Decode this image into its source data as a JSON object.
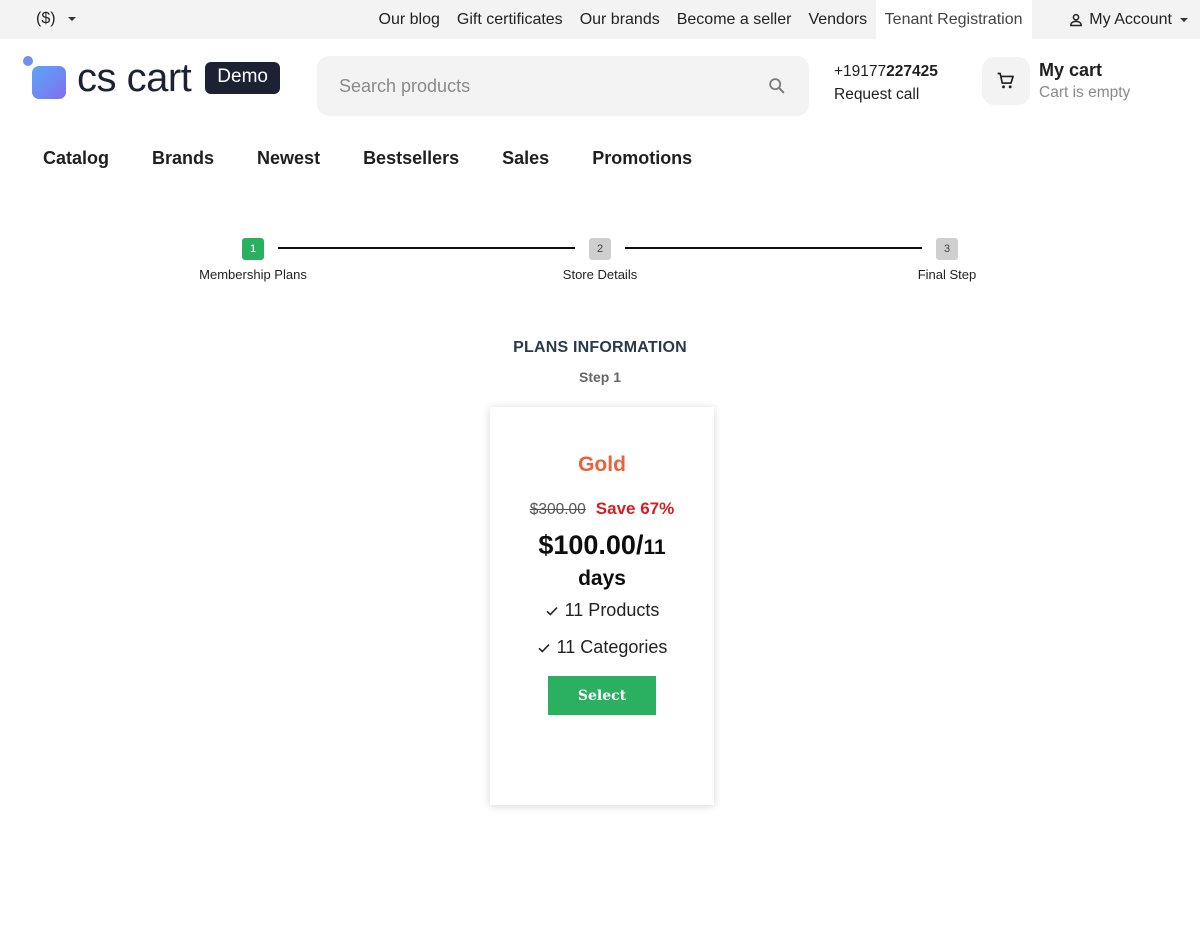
{
  "topbar": {
    "currency": "($)",
    "links": [
      "Our blog",
      "Gift certificates",
      "Our brands",
      "Become a seller",
      "Vendors",
      "Tenant Registration"
    ],
    "account": "My Account"
  },
  "header": {
    "logo_text": "cs cart",
    "demo_badge": "Demo",
    "search_placeholder": "Search products",
    "phone_prefix": "+19177",
    "phone_bold": "227425",
    "request_call": "Request call",
    "cart_title": "My cart",
    "cart_status": "Cart is empty"
  },
  "nav": [
    "Catalog",
    "Brands",
    "Newest",
    "Bestsellers",
    "Sales",
    "Promotions"
  ],
  "steps": [
    {
      "num": "1",
      "label": "Membership Plans",
      "state": "done"
    },
    {
      "num": "2",
      "label": "Store Details",
      "state": "todo"
    },
    {
      "num": "3",
      "label": "Final Step",
      "state": "todo"
    }
  ],
  "plans": {
    "title": "PLANS INFORMATION",
    "subtitle": "Step 1"
  },
  "plan_card": {
    "name": "Gold",
    "old_price": "$300.00",
    "save": "Save 67%",
    "price": "$100.00/",
    "period_num": "11",
    "period_unit": "days",
    "features": [
      "11 Products",
      "11 Categories"
    ],
    "select_label": "Select"
  },
  "colors": {
    "accent_green": "#2bb061",
    "plan_name_orange": "#e8623a",
    "save_red": "#d21f24",
    "brand_dark": "#1c2133"
  }
}
